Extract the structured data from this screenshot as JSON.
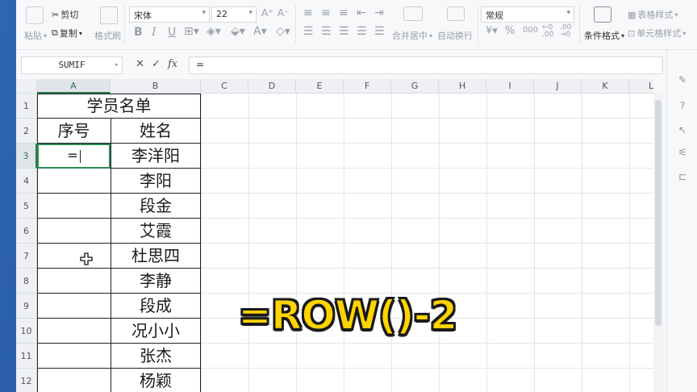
{
  "ribbon": {
    "paste": "粘贴",
    "cut": "剪切",
    "copy": "复制",
    "format_painter": "格式刷",
    "font_name": "宋体",
    "font_size": "22",
    "bold": "B",
    "italic": "I",
    "underline": "U",
    "merge_center": "合并居中",
    "wrap_text": "自动换行",
    "number_format": "常规",
    "currency": "¥",
    "percent": "%",
    "thousands": "000",
    "conditional_format": "条件格式",
    "table_style": "表格样式",
    "cell_style": "单元格样式"
  },
  "formula_bar": {
    "name_box": "SUMIF",
    "cancel": "✕",
    "enter": "✓",
    "fx": "fx",
    "content": "="
  },
  "columns": [
    "A",
    "B",
    "C",
    "D",
    "E",
    "F",
    "G",
    "H",
    "I",
    "J",
    "K",
    "L"
  ],
  "rows": [
    "1",
    "2",
    "3",
    "4",
    "5",
    "6",
    "7",
    "8",
    "9",
    "10",
    "11",
    "12"
  ],
  "sheet": {
    "title": "学员名单",
    "header_seq": "序号",
    "header_name": "姓名",
    "active_value": "=",
    "names": [
      "李洋阳",
      "李阳",
      "段金",
      "艾霞",
      "杜思四",
      "李静",
      "段成",
      "况小小",
      "张杰",
      "杨颖"
    ]
  },
  "caption": "=ROW()-2",
  "colors": {
    "accent": "#2b8a55",
    "caption": "#ffd400"
  }
}
